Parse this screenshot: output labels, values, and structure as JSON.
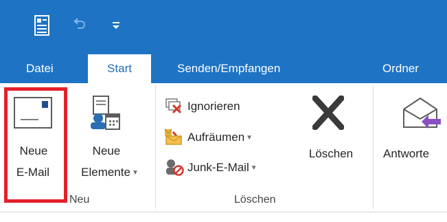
{
  "quick_access": {
    "icons": [
      "outlook-app-icon",
      "undo-icon",
      "customize-quick-access-icon"
    ]
  },
  "tabs": [
    {
      "label": "Datei"
    },
    {
      "label": "Start"
    },
    {
      "label": "Senden/Empfangen"
    },
    {
      "label": "Ordner"
    }
  ],
  "ribbon": {
    "group_neu": {
      "label": "Neu",
      "new_mail": {
        "line1": "Neue",
        "line2": "E-Mail",
        "icon": "new-mail-icon"
      },
      "new_items": {
        "line1": "Neue",
        "line2": "Elemente",
        "icon": "new-items-icon"
      }
    },
    "group_loeschen": {
      "label": "Löschen",
      "ignore": {
        "label": "Ignorieren",
        "icon": "ignore-icon"
      },
      "cleanup": {
        "label": "Aufräumen",
        "icon": "cleanup-icon"
      },
      "junk": {
        "label": "Junk-E-Mail",
        "icon": "junk-icon"
      },
      "delete": {
        "label": "Löschen",
        "icon": "delete-x-icon"
      }
    },
    "group_respond": {
      "reply": {
        "label": "Antworte",
        "icon": "reply-icon"
      }
    }
  },
  "colors": {
    "accent": "#1e73c4",
    "highlight": "#e4202b"
  }
}
